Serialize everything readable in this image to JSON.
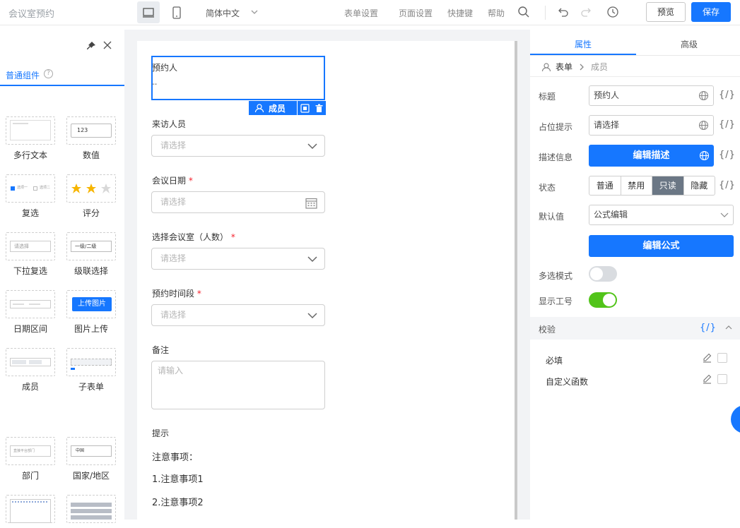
{
  "topbar": {
    "app_title": "会议室预约",
    "language": "简体中文",
    "menu": [
      "表单设置",
      "页面设置",
      "快捷键",
      "帮助"
    ],
    "preview_label": "预览",
    "save_label": "保存"
  },
  "left_panel": {
    "tab_label": "普通组件",
    "help_glyph": "?",
    "components": [
      {
        "label": "多行文本",
        "preview": "multiline"
      },
      {
        "label": "数值",
        "preview_text": "123"
      },
      {
        "label": "复选",
        "preview_texts": [
          "选项一",
          "选项二"
        ]
      },
      {
        "label": "评分",
        "preview": "stars"
      },
      {
        "label": "下拉复选",
        "preview_text": "请选择"
      },
      {
        "label": "级联选择",
        "preview_text": "一级/二级"
      },
      {
        "label": "日期区间",
        "preview": "daterange"
      },
      {
        "label": "图片上传",
        "preview_text": "上传图片"
      },
      {
        "label": "成员",
        "preview": "tags"
      },
      {
        "label": "子表单",
        "preview": "subform"
      },
      {
        "label": "部门",
        "preview_text": "直接平台部门"
      },
      {
        "label": "国家/地区",
        "preview_text": "中国"
      },
      {
        "label": "",
        "preview": "table-a"
      },
      {
        "label": "",
        "preview": "table-b"
      }
    ]
  },
  "form": {
    "selected_field": {
      "label": "预约人",
      "value": "--",
      "toolbar_label": "成员"
    },
    "fields": [
      {
        "label": "来访人员",
        "required": false,
        "placeholder": "请选择",
        "control": "select"
      },
      {
        "label": "会议日期",
        "required": true,
        "placeholder": "请选择",
        "control": "date"
      },
      {
        "label": "选择会议室（人数）",
        "required": true,
        "placeholder": "请选择",
        "control": "select"
      },
      {
        "label": "预约时间段",
        "required": true,
        "placeholder": "请选择",
        "control": "select"
      },
      {
        "label": "备注",
        "required": false,
        "placeholder": "请输入",
        "control": "textarea"
      }
    ],
    "required_mark": "*",
    "tip": {
      "label": "提示",
      "heading": "注意事项：",
      "items": [
        "1.注意事项1",
        "2.注意事项2"
      ]
    }
  },
  "right_panel": {
    "tabs": [
      "属性",
      "高级"
    ],
    "active_tab": "属性",
    "breadcrumb": [
      "表单",
      "成员"
    ],
    "fx_label": "{/}",
    "props": {
      "title_label": "标题",
      "title_value": "预约人",
      "placeholder_label": "占位提示",
      "placeholder_value": "请选择",
      "desc_label": "描述信息",
      "desc_button": "编辑描述",
      "status_label": "状态",
      "status_options": [
        "普通",
        "禁用",
        "只读",
        "隐藏"
      ],
      "status_selected": "只读",
      "default_label": "默认值",
      "default_value": "公式编辑",
      "formula_button": "编辑公式",
      "multi_label": "多选模式",
      "multi_on": false,
      "jobno_label": "显示工号",
      "jobno_on": true
    },
    "validation": {
      "label": "校验",
      "rules": [
        "必填",
        "自定义函数"
      ]
    }
  },
  "colors": {
    "primary": "#1677ff",
    "toggle_on": "#52c41a",
    "toggle_off": "#d9dce0",
    "selected_segment": "#6b7785",
    "required": "#f5222d"
  }
}
